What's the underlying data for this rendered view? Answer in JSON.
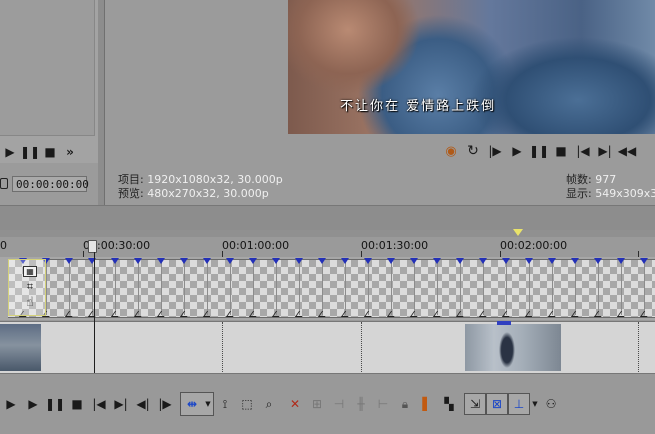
{
  "trimmer": {
    "timecode": "00:00:00:00",
    "controls": [
      "play-icon",
      "pause-icon",
      "stop-icon",
      "more-icon"
    ]
  },
  "preview": {
    "subtitle": "不让你在 爱情路上跌倒",
    "project_label": "项目:",
    "project_value": "1920x1080x32, 30.000p",
    "preview_label": "预览:",
    "preview_value": "480x270x32, 30.000p",
    "frames_label": "帧数:",
    "frames_value": "977",
    "display_label": "显示:",
    "display_value": "549x309x3",
    "controls": [
      "record-icon",
      "loop-icon",
      "play-from-start-icon",
      "play-icon",
      "pause-icon",
      "stop-icon",
      "prev-frame-icon",
      "next-frame-icon",
      "rewind-icon"
    ]
  },
  "timeline": {
    "ruler": [
      "00:00:30:00",
      "00:01:00:00",
      "00:01:30:00",
      "00:02:00:00"
    ],
    "ruler_prefix": "0"
  },
  "toolbar": {
    "transport": [
      "play-from-start-icon",
      "play-icon",
      "pause-icon",
      "stop-icon",
      "go-start-icon",
      "go-end-icon",
      "prev-frame-icon",
      "next-frame-icon"
    ],
    "edit_tools": [
      "normal-edit-tool-icon",
      "envelope-tool-icon",
      "selection-tool-icon",
      "zoom-tool-icon"
    ],
    "actions": [
      "delete-icon",
      "trim-icon",
      "trim-start-icon",
      "split-icon",
      "trim-end-icon",
      "lock-icon",
      "marker-icon",
      "region-icon"
    ],
    "snapping": [
      "auto-ripple-icon",
      "snapping-icon",
      "enable-snapping-icon",
      "grouping-icon"
    ]
  }
}
